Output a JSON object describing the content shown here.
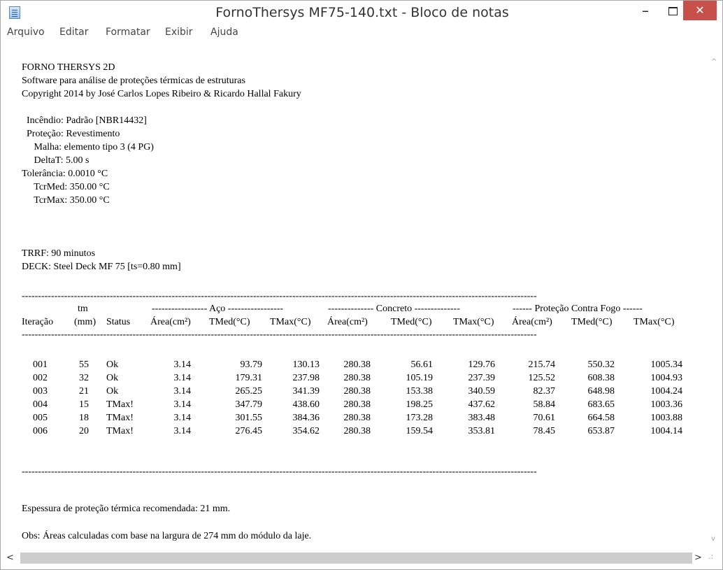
{
  "window": {
    "title": "FornoThersys MF75-140.txt - Bloco de notas",
    "min_glyph": "–",
    "close_glyph": "✕"
  },
  "menu": [
    "Arquivo",
    "Editar",
    "Formatar",
    "Exibir",
    "Ajuda"
  ],
  "header_lines": [
    "FORNO THERSYS 2D",
    "Software para análise de proteções térmicas de estruturas",
    "Copyright 2014 by José Carlos Lopes Ribeiro & Ricardo Hallal Fakury"
  ],
  "params": [
    "  Incêndio: Padrão [NBR14432]",
    "  Proteção: Revestimento",
    "     Malha: elemento tipo 3 (4 PG)",
    "     DeltaT: 5.00 s",
    "Tolerância: 0.0010 °C",
    "     TcrMed: 350.00 °C",
    "     TcrMax: 350.00 °C"
  ],
  "trrf": "TRRF: 90 minutos",
  "deck": "DECK: Steel Deck MF 75 [ts=0.80 mm]",
  "rule": "--------------------------------------------------------------------------------------------------------------------------------------------------------------",
  "table": {
    "tm_label": "tm",
    "group_aco": "----------------- Aço -----------------",
    "group_concreto": "-------------- Concreto --------------",
    "group_protecao": "------ Proteção Contra Fogo ------",
    "columns": [
      "Iteração",
      "(mm)",
      "Status",
      "Área(cm²)",
      "TMed(°C)",
      "TMax(°C)",
      "Área(cm²)",
      "TMed(°C)",
      "TMax(°C)",
      "Área(cm²)",
      "TMed(°C)",
      "TMax(°C)"
    ],
    "rows": [
      [
        "001",
        "55",
        "Ok",
        "3.14",
        "93.79",
        "130.13",
        "280.38",
        "56.61",
        "129.76",
        "215.74",
        "550.32",
        "1005.34"
      ],
      [
        "002",
        "32",
        "Ok",
        "3.14",
        "179.31",
        "237.98",
        "280.38",
        "105.19",
        "237.39",
        "125.52",
        "608.38",
        "1004.93"
      ],
      [
        "003",
        "21",
        "Ok",
        "3.14",
        "265.25",
        "341.39",
        "280.38",
        "153.38",
        "340.59",
        "82.37",
        "648.98",
        "1004.24"
      ],
      [
        "004",
        "15",
        "TMax!",
        "3.14",
        "347.79",
        "438.60",
        "280.38",
        "198.25",
        "437.62",
        "58.84",
        "683.65",
        "1003.36"
      ],
      [
        "005",
        "18",
        "TMax!",
        "3.14",
        "301.55",
        "384.36",
        "280.38",
        "173.28",
        "383.48",
        "70.61",
        "664.58",
        "1003.88"
      ],
      [
        "006",
        "20",
        "TMax!",
        "3.14",
        "276.45",
        "354.62",
        "280.38",
        "159.54",
        "353.81",
        "78.45",
        "653.87",
        "1004.14"
      ]
    ]
  },
  "recommendation": "Espessura de proteção térmica recomendada: 21 mm.",
  "obs": "Obs: Áreas calculadas com base na largura de 274 mm do módulo da laje.",
  "scroll": {
    "up": "^",
    "down": "v",
    "left": "<",
    "right": ">",
    "grip": ".:"
  }
}
